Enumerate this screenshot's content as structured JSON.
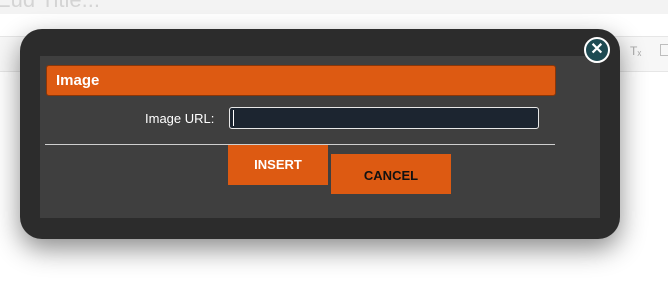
{
  "background": {
    "title_fragment": "Eud Title...",
    "toolbar_clear_format_glyph": "Tₓ"
  },
  "dialog": {
    "title": "Image",
    "url_label": "Image URL:",
    "url_value": "",
    "insert_label": "INSERT",
    "cancel_label": "CANCEL",
    "close_glyph": "✕"
  },
  "colors": {
    "accent": "#dd5a12",
    "dialog_bg": "#3f3f3f",
    "dialog_frame": "#2c2c2c",
    "input_bg": "#1c2530",
    "close_bg": "#1e4a52"
  }
}
